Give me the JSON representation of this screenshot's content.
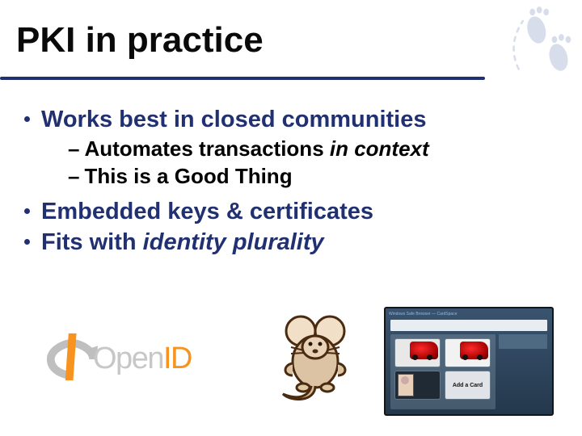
{
  "title": "PKI in practice",
  "bullets": {
    "b1": "Works best in closed communities",
    "b1s1_pre": "Automates transactions ",
    "b1s1_em": "in context",
    "b1s2": "This is a Good Thing",
    "b2": "Embedded keys & certificates",
    "b3_pre": "Fits with ",
    "b3_em": "identity plurality"
  },
  "logos": {
    "openid_open": "Open",
    "openid_id": "ID",
    "cardspace_top": "Windows Safe Browser — CardSpace",
    "addcard": "Add a Card"
  }
}
